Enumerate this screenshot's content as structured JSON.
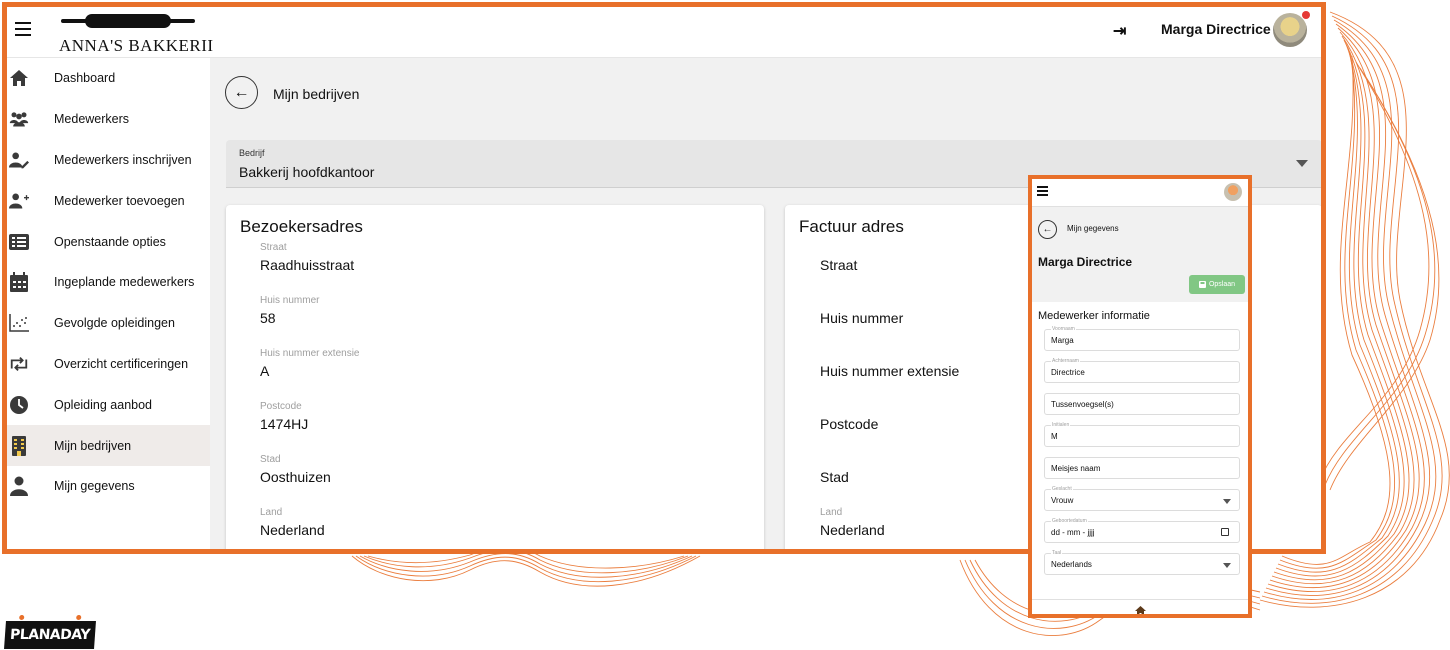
{
  "app": {
    "logo_text": "ANNA'S BAKKERII",
    "user_name": "Marga Directrice",
    "logout_glyph": "⇥",
    "brand_logo_text": "PLANADAY",
    "accent_color": "#e8702a"
  },
  "sidebar": {
    "items": [
      {
        "label": "Dashboard",
        "icon": "home-icon"
      },
      {
        "label": "Medewerkers",
        "icon": "people-icon"
      },
      {
        "label": "Medewerkers inschrijven",
        "icon": "person-edit-icon"
      },
      {
        "label": "Medewerker toevoegen",
        "icon": "person-add-icon"
      },
      {
        "label": "Openstaande opties",
        "icon": "list-icon"
      },
      {
        "label": "Ingeplande medewerkers",
        "icon": "calendar-icon"
      },
      {
        "label": "Gevolgde opleidingen",
        "icon": "scatter-chart-icon"
      },
      {
        "label": "Overzicht certificeringen",
        "icon": "repeat-icon"
      },
      {
        "label": "Opleiding aanbod",
        "icon": "clock-icon"
      },
      {
        "label": "Mijn bedrijven",
        "icon": "building-icon",
        "active": true
      },
      {
        "label": "Mijn gegevens",
        "icon": "person-icon"
      }
    ]
  },
  "main": {
    "back_glyph": "←",
    "page_title": "Mijn bedrijven",
    "company_select": {
      "label": "Bedrijf",
      "value": "Bakkerij hoofdkantoor"
    },
    "visitor_address": {
      "title": "Bezoekersadres",
      "fields": [
        {
          "label": "Straat",
          "value": "Raadhuisstraat"
        },
        {
          "label": "Huis nummer",
          "value": "58"
        },
        {
          "label": "Huis nummer extensie",
          "value": "A"
        },
        {
          "label": "Postcode",
          "value": "1474HJ"
        },
        {
          "label": "Stad",
          "value": "Oosthuizen"
        },
        {
          "label": "Land",
          "value": "Nederland"
        }
      ]
    },
    "invoice_address": {
      "title": "Factuur adres",
      "placeholders": [
        "Straat",
        "Huis nummer",
        "Huis nummer extensie",
        "Postcode",
        "Stad"
      ],
      "land_label": "Land",
      "land_value": "Nederland"
    }
  },
  "mobile": {
    "back_glyph": "←",
    "page_title": "Mijn gegevens",
    "user_name": "Marga Directrice",
    "save_label": "Opslaan",
    "section_title": "Medewerker informatie",
    "fields": [
      {
        "label": "Voornaam",
        "value": "Marga"
      },
      {
        "label": "Achternaam",
        "value": "Directrice"
      },
      {
        "label": "",
        "value": "Tussenvoegsel(s)"
      },
      {
        "label": "Initialen",
        "value": "M"
      },
      {
        "label": "",
        "value": "Meisjes naam"
      },
      {
        "label": "Geslacht",
        "value": "Vrouw"
      },
      {
        "label": "Geboortedatum",
        "value": "dd - mm - jjjj"
      },
      {
        "label": "Taal",
        "value": "Nederlands"
      }
    ]
  }
}
